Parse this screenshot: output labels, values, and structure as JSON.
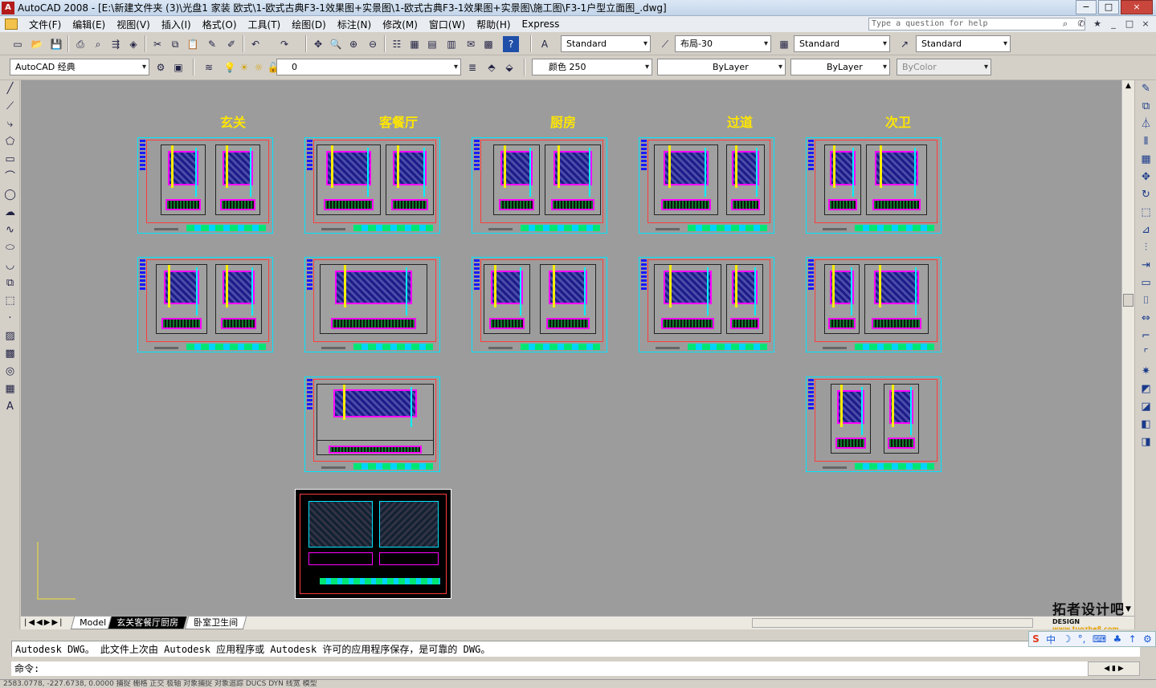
{
  "window": {
    "title": "AutoCAD 2008 - [E:\\新建文件夹 (3)\\光盘1 家装 欧式\\1-欧式古典F3-1效果图+实景图\\1-欧式古典F3-1效果图+实景图\\施工图\\F3-1户型立面图_.dwg]",
    "icon": "A",
    "buttons": [
      "−",
      "□",
      "×"
    ],
    "doc_buttons": [
      "_",
      "□",
      "×"
    ]
  },
  "menu": {
    "items": [
      "文件(F)",
      "编辑(E)",
      "视图(V)",
      "插入(I)",
      "格式(O)",
      "工具(T)",
      "绘图(D)",
      "标注(N)",
      "修改(M)",
      "窗口(W)",
      "帮助(H)",
      "Express"
    ],
    "help_placeholder": "Type a question for help"
  },
  "styles_toolbar": {
    "text_style": "Standard",
    "dim_style": "布局-30",
    "table_style": "Standard",
    "multileader_style": "Standard"
  },
  "layers_toolbar": {
    "workspace": "AutoCAD 经典",
    "layer": "0",
    "color": "颜色 250",
    "linetype": "ByLayer",
    "lineweight": "ByLayer",
    "plotstyle": "ByColor"
  },
  "room_labels": [
    "玄关",
    "客餐厅",
    "厨房",
    "过道",
    "次卫"
  ],
  "tabs": {
    "model": "Model",
    "layout1": "玄关客餐厅厨房",
    "layout2": "卧室卫生间"
  },
  "command": {
    "history": "Autodesk DWG。  此文件上次由 Autodesk 应用程序或 Autodesk 许可的应用程序保存，是可靠的 DWG。",
    "prompt": "命令:"
  },
  "ime": [
    "S",
    "中",
    "☽",
    "°,",
    "⌨",
    "♣",
    "↑",
    "⚙"
  ],
  "watermark": {
    "title": "拓者设计吧",
    "sub_prefix": "DESIGN",
    "sub_url": "www.tuozhe8.com"
  },
  "status_line": "2583.0778, -227.6738, 0.0000    捕捉  栅格  正交  极轴  对象捕捉  对象追踪  DUCS  DYN  线宽  模型"
}
